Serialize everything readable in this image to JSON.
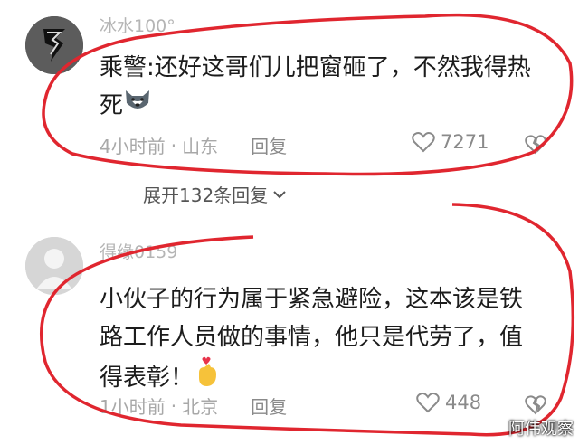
{
  "comments": [
    {
      "username": "冰水100°",
      "lines": [
        "乘警:还好这哥们儿把窗砸了，不然我得热",
        "死"
      ],
      "time": "4小时前",
      "location": "山东",
      "reply_label": "回复",
      "likes": "7271",
      "emoji": "husky-face-emoji"
    },
    {
      "username": "得缘0159",
      "lines": [
        "小伙子的行为属于紧急避险，这本该是铁",
        "路工作人员做的事情，他只是代劳了，值",
        "得表彰！"
      ],
      "time": "1小时前",
      "location": "北京",
      "reply_label": "回复",
      "likes": "448",
      "emoji": "finger-heart-emoji"
    }
  ],
  "expand_replies_label": "展开132条回复",
  "watermark": "阿伟观察",
  "colors": {
    "annotation_red": "#e0262f",
    "meta_gray": "#a8a8a8"
  }
}
